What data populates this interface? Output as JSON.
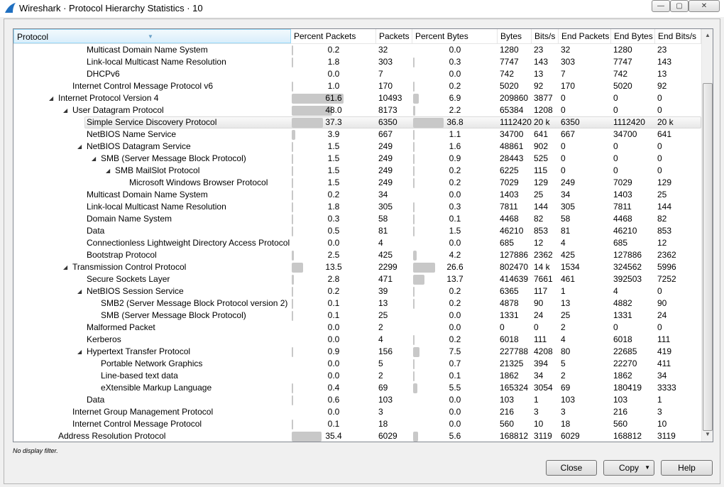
{
  "window": {
    "title": "Wireshark · Protocol Hierarchy Statistics · 10",
    "minimize": "—",
    "maximize": "▢",
    "close": "✕"
  },
  "columns": [
    "Protocol",
    "Percent Packets",
    "Packets",
    "Percent Bytes",
    "Bytes",
    "Bits/s",
    "End Packets",
    "End Bytes",
    "End Bits/s"
  ],
  "rows": [
    {
      "name": "Multicast Domain Name System",
      "depth": 3,
      "exp": false,
      "pp": 0.2,
      "packets": "32",
      "pb": 0.0,
      "bytes": "1280",
      "bits": "23",
      "endp": "32",
      "endb": "1280",
      "endbits": "23"
    },
    {
      "name": "Link-local Multicast Name Resolution",
      "depth": 3,
      "exp": false,
      "pp": 1.8,
      "packets": "303",
      "pb": 0.3,
      "bytes": "7747",
      "bits": "143",
      "endp": "303",
      "endb": "7747",
      "endbits": "143"
    },
    {
      "name": "DHCPv6",
      "depth": 3,
      "exp": false,
      "pp": 0.0,
      "packets": "7",
      "pb": 0.0,
      "bytes": "742",
      "bits": "13",
      "endp": "7",
      "endb": "742",
      "endbits": "13"
    },
    {
      "name": "Internet Control Message Protocol v6",
      "depth": 2,
      "exp": false,
      "pp": 1.0,
      "packets": "170",
      "pb": 0.2,
      "bytes": "5020",
      "bits": "92",
      "endp": "170",
      "endb": "5020",
      "endbits": "92"
    },
    {
      "name": "Internet Protocol Version 4",
      "depth": 1,
      "exp": true,
      "pp": 61.6,
      "packets": "10493",
      "pb": 6.9,
      "bytes": "209860",
      "bits": "3877",
      "endp": "0",
      "endb": "0",
      "endbits": "0"
    },
    {
      "name": "User Datagram Protocol",
      "depth": 2,
      "exp": true,
      "pp": 48.0,
      "packets": "8173",
      "pb": 2.2,
      "bytes": "65384",
      "bits": "1208",
      "endp": "0",
      "endb": "0",
      "endbits": "0"
    },
    {
      "name": "Simple Service Discovery Protocol",
      "depth": 3,
      "exp": false,
      "selected": true,
      "pp": 37.3,
      "packets": "6350",
      "pb": 36.8,
      "bytes": "1112420",
      "bits": "20 k",
      "endp": "6350",
      "endb": "1112420",
      "endbits": "20 k"
    },
    {
      "name": "NetBIOS Name Service",
      "depth": 3,
      "exp": false,
      "pp": 3.9,
      "packets": "667",
      "pb": 1.1,
      "bytes": "34700",
      "bits": "641",
      "endp": "667",
      "endb": "34700",
      "endbits": "641"
    },
    {
      "name": "NetBIOS Datagram Service",
      "depth": 3,
      "exp": true,
      "pp": 1.5,
      "packets": "249",
      "pb": 1.6,
      "bytes": "48861",
      "bits": "902",
      "endp": "0",
      "endb": "0",
      "endbits": "0"
    },
    {
      "name": "SMB (Server Message Block Protocol)",
      "depth": 4,
      "exp": true,
      "pp": 1.5,
      "packets": "249",
      "pb": 0.9,
      "bytes": "28443",
      "bits": "525",
      "endp": "0",
      "endb": "0",
      "endbits": "0"
    },
    {
      "name": "SMB MailSlot Protocol",
      "depth": 5,
      "exp": true,
      "pp": 1.5,
      "packets": "249",
      "pb": 0.2,
      "bytes": "6225",
      "bits": "115",
      "endp": "0",
      "endb": "0",
      "endbits": "0"
    },
    {
      "name": "Microsoft Windows Browser Protocol",
      "depth": 6,
      "exp": false,
      "pp": 1.5,
      "packets": "249",
      "pb": 0.2,
      "bytes": "7029",
      "bits": "129",
      "endp": "249",
      "endb": "7029",
      "endbits": "129"
    },
    {
      "name": "Multicast Domain Name System",
      "depth": 3,
      "exp": false,
      "pp": 0.2,
      "packets": "34",
      "pb": 0.0,
      "bytes": "1403",
      "bits": "25",
      "endp": "34",
      "endb": "1403",
      "endbits": "25"
    },
    {
      "name": "Link-local Multicast Name Resolution",
      "depth": 3,
      "exp": false,
      "pp": 1.8,
      "packets": "305",
      "pb": 0.3,
      "bytes": "7811",
      "bits": "144",
      "endp": "305",
      "endb": "7811",
      "endbits": "144"
    },
    {
      "name": "Domain Name System",
      "depth": 3,
      "exp": false,
      "pp": 0.3,
      "packets": "58",
      "pb": 0.1,
      "bytes": "4468",
      "bits": "82",
      "endp": "58",
      "endb": "4468",
      "endbits": "82"
    },
    {
      "name": "Data",
      "depth": 3,
      "exp": false,
      "pp": 0.5,
      "packets": "81",
      "pb": 1.5,
      "bytes": "46210",
      "bits": "853",
      "endp": "81",
      "endb": "46210",
      "endbits": "853"
    },
    {
      "name": "Connectionless Lightweight Directory Access Protocol",
      "depth": 3,
      "exp": false,
      "pp": 0.0,
      "packets": "4",
      "pb": 0.0,
      "bytes": "685",
      "bits": "12",
      "endp": "4",
      "endb": "685",
      "endbits": "12"
    },
    {
      "name": "Bootstrap Protocol",
      "depth": 3,
      "exp": false,
      "pp": 2.5,
      "packets": "425",
      "pb": 4.2,
      "bytes": "127886",
      "bits": "2362",
      "endp": "425",
      "endb": "127886",
      "endbits": "2362"
    },
    {
      "name": "Transmission Control Protocol",
      "depth": 2,
      "exp": true,
      "pp": 13.5,
      "packets": "2299",
      "pb": 26.6,
      "bytes": "802470",
      "bits": "14 k",
      "endp": "1534",
      "endb": "324562",
      "endbits": "5996"
    },
    {
      "name": "Secure Sockets Layer",
      "depth": 3,
      "exp": false,
      "pp": 2.8,
      "packets": "471",
      "pb": 13.7,
      "bytes": "414639",
      "bits": "7661",
      "endp": "461",
      "endb": "392503",
      "endbits": "7252"
    },
    {
      "name": "NetBIOS Session Service",
      "depth": 3,
      "exp": true,
      "pp": 0.2,
      "packets": "39",
      "pb": 0.2,
      "bytes": "6365",
      "bits": "117",
      "endp": "1",
      "endb": "4",
      "endbits": "0"
    },
    {
      "name": "SMB2 (Server Message Block Protocol version 2)",
      "depth": 4,
      "exp": false,
      "pp": 0.1,
      "packets": "13",
      "pb": 0.2,
      "bytes": "4878",
      "bits": "90",
      "endp": "13",
      "endb": "4882",
      "endbits": "90"
    },
    {
      "name": "SMB (Server Message Block Protocol)",
      "depth": 4,
      "exp": false,
      "pp": 0.1,
      "packets": "25",
      "pb": 0.0,
      "bytes": "1331",
      "bits": "24",
      "endp": "25",
      "endb": "1331",
      "endbits": "24"
    },
    {
      "name": "Malformed Packet",
      "depth": 3,
      "exp": false,
      "pp": 0.0,
      "packets": "2",
      "pb": 0.0,
      "bytes": "0",
      "bits": "0",
      "endp": "2",
      "endb": "0",
      "endbits": "0"
    },
    {
      "name": "Kerberos",
      "depth": 3,
      "exp": false,
      "pp": 0.0,
      "packets": "4",
      "pb": 0.2,
      "bytes": "6018",
      "bits": "111",
      "endp": "4",
      "endb": "6018",
      "endbits": "111"
    },
    {
      "name": "Hypertext Transfer Protocol",
      "depth": 3,
      "exp": true,
      "pp": 0.9,
      "packets": "156",
      "pb": 7.5,
      "bytes": "227788",
      "bits": "4208",
      "endp": "80",
      "endb": "22685",
      "endbits": "419"
    },
    {
      "name": "Portable Network Graphics",
      "depth": 4,
      "exp": false,
      "pp": 0.0,
      "packets": "5",
      "pb": 0.7,
      "bytes": "21325",
      "bits": "394",
      "endp": "5",
      "endb": "22270",
      "endbits": "411"
    },
    {
      "name": "Line-based text data",
      "depth": 4,
      "exp": false,
      "pp": 0.0,
      "packets": "2",
      "pb": 0.1,
      "bytes": "1862",
      "bits": "34",
      "endp": "2",
      "endb": "1862",
      "endbits": "34"
    },
    {
      "name": "eXtensible Markup Language",
      "depth": 4,
      "exp": false,
      "pp": 0.4,
      "packets": "69",
      "pb": 5.5,
      "bytes": "165324",
      "bits": "3054",
      "endp": "69",
      "endb": "180419",
      "endbits": "3333"
    },
    {
      "name": "Data",
      "depth": 3,
      "exp": false,
      "pp": 0.6,
      "packets": "103",
      "pb": 0.0,
      "bytes": "103",
      "bits": "1",
      "endp": "103",
      "endb": "103",
      "endbits": "1"
    },
    {
      "name": "Internet Group Management Protocol",
      "depth": 2,
      "exp": false,
      "pp": 0.0,
      "packets": "3",
      "pb": 0.0,
      "bytes": "216",
      "bits": "3",
      "endp": "3",
      "endb": "216",
      "endbits": "3"
    },
    {
      "name": "Internet Control Message Protocol",
      "depth": 2,
      "exp": false,
      "pp": 0.1,
      "packets": "18",
      "pb": 0.0,
      "bytes": "560",
      "bits": "10",
      "endp": "18",
      "endb": "560",
      "endbits": "10"
    },
    {
      "name": "Address Resolution Protocol",
      "depth": 1,
      "exp": false,
      "pp": 35.4,
      "packets": "6029",
      "pb": 5.6,
      "bytes": "168812",
      "bits": "3119",
      "endp": "6029",
      "endb": "168812",
      "endbits": "3119"
    }
  ],
  "filter_text": "No display filter.",
  "buttons": {
    "close": "Close",
    "copy": "Copy",
    "help": "Help"
  },
  "colors": {
    "bar": "#c8c8c8",
    "header_sorted": "#d9eefb"
  }
}
